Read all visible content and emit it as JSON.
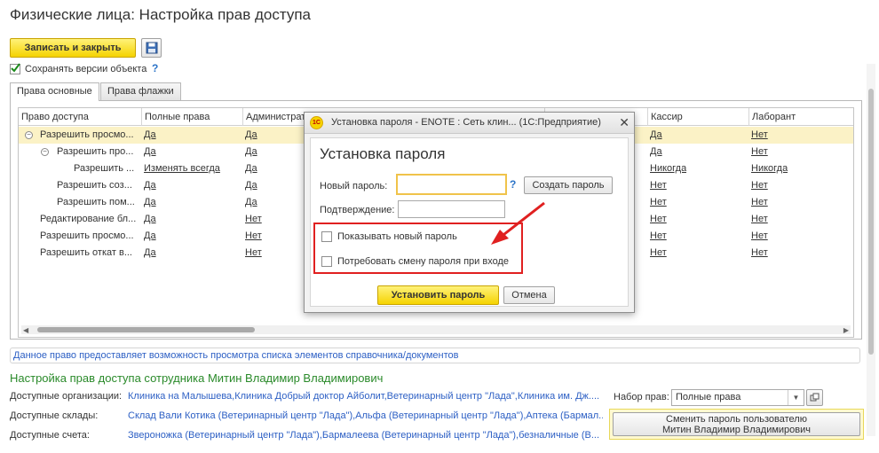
{
  "page": {
    "title": "Физические лица: Настройка прав доступа"
  },
  "toolbar": {
    "save_close": "Записать и закрыть",
    "save_versions": "Сохранять версии объекта",
    "help": "?"
  },
  "tabs": [
    {
      "label": "Права основные",
      "active": true
    },
    {
      "label": "Права флажки",
      "active": false
    }
  ],
  "grid": {
    "headers": {
      "c0": "Право доступа",
      "c1": "Полные права",
      "c2": "Администрат...",
      "c3": "Кассир",
      "c4": "Лаборант"
    },
    "rows": [
      {
        "name": "Разрешить просмо...",
        "c1": "Да",
        "c2": "Да",
        "c3": "Да",
        "c4": "Нет"
      },
      {
        "name": "Разрешить про...",
        "c1": "Да",
        "c2": "Да",
        "c3": "Да",
        "c4": "Нет"
      },
      {
        "name": "Разрешить ...",
        "c1": "Изменять всегда",
        "c2": "Да",
        "c3": "Никогда",
        "c4": "Никогда"
      },
      {
        "name": "Разрешить соз...",
        "c1": "Да",
        "c2": "Да",
        "c3": "Нет",
        "c4": "Нет"
      },
      {
        "name": "Разрешить пом...",
        "c1": "Да",
        "c2": "Да",
        "c3": "Нет",
        "c4": "Нет"
      },
      {
        "name": "Редактирование бл...",
        "c1": "Да",
        "c2": "Нет",
        "c3": "Нет",
        "c4": "Нет"
      },
      {
        "name": "Разрешить просмо...",
        "c1": "Да",
        "c2": "Нет",
        "c3": "Нет",
        "c4": "Нет"
      },
      {
        "name": "Разрешить откат в...",
        "c1": "Да",
        "c2": "Нет",
        "c3": "Нет",
        "c4": "Нет"
      }
    ]
  },
  "info_text": "Данное право предоставляет возможность просмотра списка элементов справочника/документов",
  "employee": {
    "heading": "Настройка прав доступа сотрудника Митин Владимир Владимирович",
    "org_label": "Доступные организации:",
    "org_value": "Клиника на Малышева,Клиника Добрый доктор Айболит,Ветеринарный центр \"Лада\",Клиника им. Дж....",
    "store_label": "Доступные склады:",
    "store_value": "Склад Вали Котика (Ветеринарный центр \"Лада\"),Альфа (Ветеринарный центр \"Лада\"),Аптека (Бармал...",
    "acct_label": "Доступные счета:",
    "acct_value": "Звероножка (Ветеринарный центр \"Лада\"),Бармалеева (Ветеринарный центр \"Лада\"),безналичные (В...",
    "rights_set_label": "Набор прав:",
    "rights_set_value": "Полные права",
    "change_pwd_line1": "Сменить пароль пользователю",
    "change_pwd_line2": "Митин Владимир Владимирович"
  },
  "dialog": {
    "window_title": "Установка пароля - ENOTE : Сеть клин... (1С:Предприятие)",
    "logo_text": "1С",
    "heading": "Установка пароля",
    "new_pwd_label": "Новый пароль:",
    "help": "?",
    "create_pwd": "Создать пароль",
    "confirm_label": "Подтверждение:",
    "show_pwd": "Показывать новый пароль",
    "require_change": "Потребовать смену пароля при входе",
    "set_pwd": "Установить пароль",
    "cancel": "Отмена"
  },
  "colors": {
    "accent_yellow": "#f5d300",
    "highlight_red": "#e02020",
    "heading_green": "#2a8a2a",
    "link_blue": "#2c5fc4"
  }
}
